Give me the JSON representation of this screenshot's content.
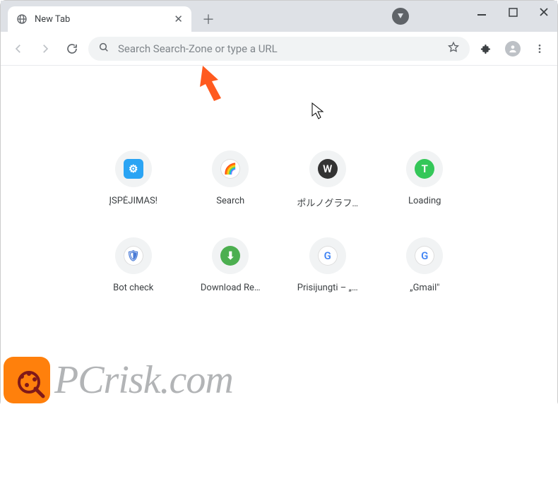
{
  "tab": {
    "title": "New Tab"
  },
  "omnibox": {
    "placeholder": "Search Search-Zone or type a URL"
  },
  "shortcuts": [
    {
      "label": "ĮSPĖJIMAS!",
      "bg": "#2aa4f4",
      "glyph": "⚙",
      "fg": "#ffffff",
      "round": false
    },
    {
      "label": "Search",
      "bg": "#ffffff",
      "glyph": "🌈",
      "fg": "#000000",
      "round": true
    },
    {
      "label": "ポルノグラフ…",
      "bg": "#333333",
      "glyph": "W",
      "fg": "#ffffff",
      "round": true
    },
    {
      "label": "Loading",
      "bg": "#34c759",
      "glyph": "T",
      "fg": "#ffffff",
      "round": true
    },
    {
      "label": "Bot check",
      "bg": "#ffffff",
      "glyph": "🛡",
      "fg": "#4a7bd6",
      "round": true
    },
    {
      "label": "Download Re…",
      "bg": "#4caf50",
      "glyph": "⬇",
      "fg": "#ffffff",
      "round": true
    },
    {
      "label": "Prisijungti – „…",
      "bg": "#ffffff",
      "glyph": "G",
      "fg": "#4285f4",
      "round": true
    },
    {
      "label": "„Gmail\"",
      "bg": "#ffffff",
      "glyph": "G",
      "fg": "#4285f4",
      "round": true
    }
  ],
  "watermark": {
    "text": "PCrisk.com"
  }
}
